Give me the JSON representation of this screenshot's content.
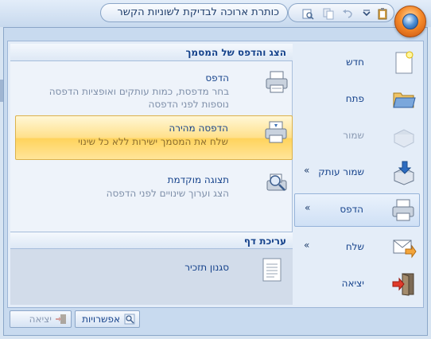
{
  "window": {
    "title": "כותרת ארוכה לבדיקת לשוניות הקשר"
  },
  "menu": {
    "left_items": [
      {
        "label": "חדש",
        "icon": "new-document-icon",
        "arrow": false,
        "disabled": false
      },
      {
        "label": "פתח",
        "icon": "open-folder-icon",
        "arrow": false,
        "disabled": false
      },
      {
        "label": "שמור",
        "icon": "save-icon",
        "arrow": false,
        "disabled": true
      },
      {
        "label": "שמור עותק",
        "icon": "save-as-icon",
        "arrow": true,
        "disabled": false
      },
      {
        "label": "הדפס",
        "icon": "printer-icon",
        "arrow": true,
        "disabled": false
      },
      {
        "label": "שלח",
        "icon": "send-mail-icon",
        "arrow": true,
        "disabled": false
      },
      {
        "label": "יציאה",
        "icon": "exit-icon",
        "arrow": false,
        "disabled": false
      }
    ],
    "submenu": {
      "header": "הצג והדפס של המסמך",
      "options": [
        {
          "title": "הדפס",
          "desc1": "בחר מדפסת, כמות עותקים ואופציות הדפסה",
          "desc2": "נוספות לפני הדפסה",
          "icon": "printer-icon"
        },
        {
          "title": "הדפסה מהירה",
          "desc1": "שלח את המסמך ישירות ללא כל שינוי",
          "desc2": "",
          "icon": "quick-print-icon"
        },
        {
          "title": "תצוגה מוקדמת",
          "desc1": "הצג וערוך שינויים לפני הדפסה",
          "desc2": "",
          "icon": "print-preview-icon"
        }
      ],
      "section2_header": "עריכת דף",
      "section2_item": "סגנון תזכיר"
    }
  },
  "footer": {
    "options_label": "אפשרויות",
    "exit_label": "יציאה"
  }
}
